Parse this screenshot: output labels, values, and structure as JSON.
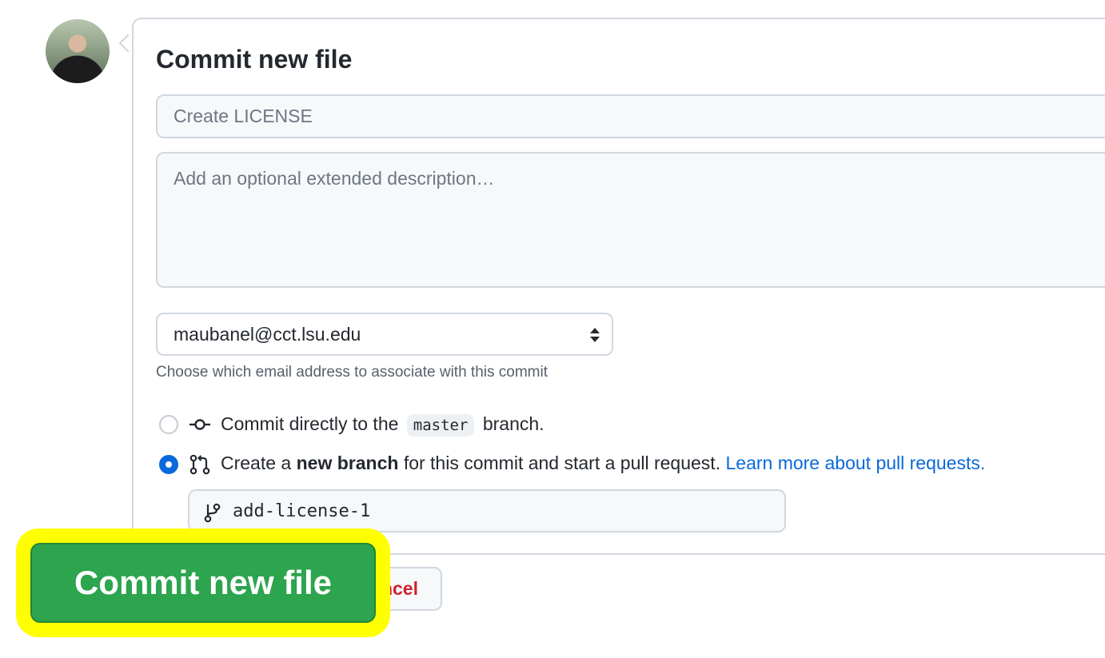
{
  "form": {
    "title": "Commit new file",
    "summary_placeholder": "Create LICENSE",
    "description_placeholder": "Add an optional extended description…",
    "email_selected": "maubanel@cct.lsu.edu",
    "email_hint": "Choose which email address to associate with this commit"
  },
  "options": {
    "direct": {
      "prefix": "Commit directly to the",
      "branch": "master",
      "suffix": "branch.",
      "selected": false
    },
    "new_branch": {
      "prefix": "Create a",
      "bold": "new branch",
      "suffix": "for this commit and start a pull request.",
      "link": "Learn more about pull requests.",
      "selected": true
    }
  },
  "branch_name": "add-license-1",
  "buttons": {
    "commit": "Commit new file",
    "cancel": "Cancel"
  },
  "colors": {
    "primary_green": "#2da44e",
    "highlight_yellow": "#ffff00",
    "link_blue": "#0969da",
    "danger_red": "#cf222e"
  },
  "icons": {
    "commit": "git-commit-icon",
    "pull_request": "git-pull-request-icon",
    "branch": "git-branch-icon",
    "select": "select-arrows-icon"
  }
}
